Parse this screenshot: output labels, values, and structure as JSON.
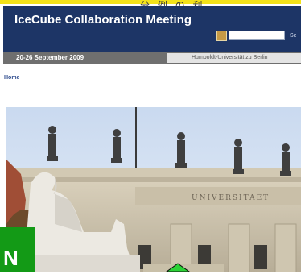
{
  "header": {
    "title": "IceCube Collaboration Meeting",
    "top_glyphs": "分 例 の 利",
    "search": {
      "button_label": "Se"
    }
  },
  "subheader": {
    "dates": "20-26 September 2009",
    "venue": "Humboldt-Universität zu Berlin"
  },
  "nav": {
    "home_label": "Home"
  },
  "photo": {
    "inscription": "UNIVERSITAET"
  },
  "overlay": {
    "letter": "N"
  },
  "colors": {
    "accent_yellow": "#f3e21a",
    "header_navy": "#1d3566",
    "date_bar_gray": "#6f6f6f",
    "overlay_green": "#139a16"
  }
}
